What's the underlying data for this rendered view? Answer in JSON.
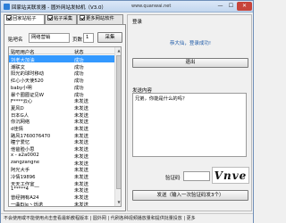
{
  "window": {
    "title": "回家站关联发器 - 圆外网站发帖机（V3.0）",
    "url": "www.quanwai.net",
    "version": "V3.0",
    "min_glyph": "—",
    "max_glyph": "☐",
    "close_glyph": "✕"
  },
  "tabs": [
    {
      "label": "回家站帖子"
    },
    {
      "label": "帖子采集"
    },
    {
      "label": "更多网站软件"
    }
  ],
  "collect": {
    "keyword_label": "贴吧名",
    "keyword_value": "网络营销",
    "page_label": "页数",
    "page_value": "1",
    "collect_button": "采集"
  },
  "list": {
    "columns": [
      "贴吧用户名",
      "状态"
    ],
    "rows": [
      {
        "name": "刘老大加油",
        "status": "成功"
      },
      {
        "name": "潮联文",
        "status": "成功"
      },
      {
        "name": "阳光的球时移动",
        "status": "成功"
      },
      {
        "name": "红心小天使520",
        "status": "成功"
      },
      {
        "name": "baby小明",
        "status": "成功"
      },
      {
        "name": "暴个圈圈证见W",
        "status": "成功"
      },
      {
        "name": "F****云心",
        "status": "未发送"
      },
      {
        "name": "夏风D",
        "status": "未发送"
      },
      {
        "name": "日本G人",
        "status": "未发送"
      },
      {
        "name": "你沉网络",
        "status": "未发送"
      },
      {
        "name": "d佳情",
        "status": "未发送"
      },
      {
        "name": "路风1760076470",
        "status": "未发送"
      },
      {
        "name": "瞳宁爱忆",
        "status": "未发送"
      },
      {
        "name": "他爸脸小思",
        "status": "未发送"
      },
      {
        "name": "x - a2a0002",
        "status": "未发送"
      },
      {
        "name": "zangzangne",
        "status": "未发送"
      },
      {
        "name": "阿光大手",
        "status": "未发送"
      },
      {
        "name": "冷情19896",
        "status": "未发送"
      },
      {
        "name": "天天工作室__",
        "status": "未发送"
      },
      {
        "name": "1*****4",
        "status": "未发送"
      },
      {
        "name": "曾经拥有A24",
        "status": "未发送"
      },
      {
        "name": "一曲Eile丶烁诺",
        "status": "未发送"
      }
    ]
  },
  "login": {
    "group_label": "登录",
    "success_message": "恭大仙，登录成功!",
    "exit_button": "退出"
  },
  "send": {
    "content_label": "发送内容",
    "content_value": "兄弟，你能是什么的吗？",
    "captcha_label": "验证码",
    "captcha_image_text": "Vnve",
    "send_button": "发送（输入一次验证码发3个）"
  },
  "status_bar": {
    "text": "不会使用或不能使用点击查看最新教程版本 | 圆外网 | 代刷各种视频播放量和提供批量投放 | 更多"
  }
}
